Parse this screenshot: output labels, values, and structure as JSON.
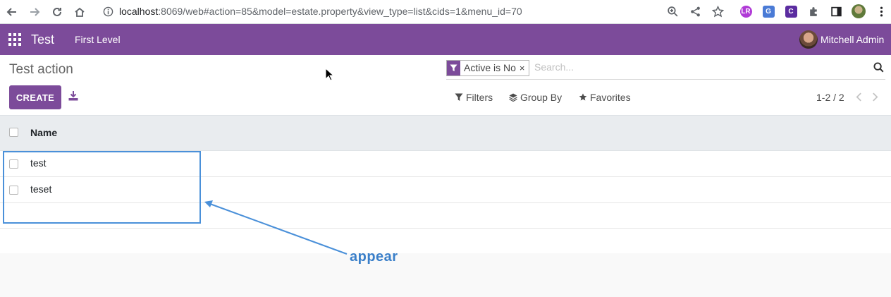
{
  "browser": {
    "url_host": "localhost",
    "url_rest": ":8069/web#action=85&model=estate.property&view_type=list&cids=1&menu_id=70"
  },
  "navbar": {
    "app_name": "Test",
    "menu_item": "First Level",
    "user_name": "Mitchell Admin",
    "color": "#7c4b9a"
  },
  "control_panel": {
    "breadcrumb_title": "Test action",
    "create_label": "CREATE",
    "search": {
      "facet_value": "Active is No",
      "facet_remove": "×",
      "placeholder": "Search..."
    },
    "filters_label": "Filters",
    "group_by_label": "Group By",
    "favorites_label": "Favorites",
    "pager_value": "1-2 / 2"
  },
  "list": {
    "columns": [
      "Name"
    ],
    "rows": [
      {
        "name": "test"
      },
      {
        "name": "teset"
      }
    ]
  },
  "annotation": {
    "text": "appear",
    "color": "#4a90d9"
  }
}
